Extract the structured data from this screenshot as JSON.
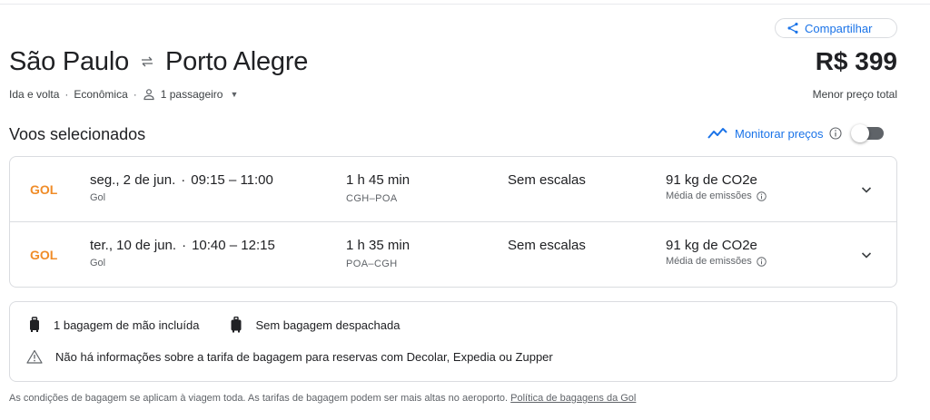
{
  "share": {
    "label": "Compartilhar",
    "icon": "share-icon"
  },
  "route": {
    "origin": "São Paulo",
    "destination": "Porto Alegre",
    "icon": "swap-arrows-icon"
  },
  "price": {
    "value": "R$ 399",
    "caption": "Menor preço total"
  },
  "trip": {
    "type": "Ida e volta",
    "cabin": "Econômica",
    "passengers": "1 passageiro"
  },
  "section": {
    "title": "Voos selecionados"
  },
  "monitor": {
    "label": "Monitorar preços",
    "enabled": false
  },
  "flights": [
    {
      "airline_logo": "GOL",
      "date_label": "seg., 2 de jun.",
      "times": "09:15 – 11:00",
      "airline": "Gol",
      "duration": "1 h 45 min",
      "route": "CGH–POA",
      "stops": "Sem escalas",
      "co2": "91 kg de CO2e",
      "emission_note": "Média de emissões"
    },
    {
      "airline_logo": "GOL",
      "date_label": "ter., 10 de jun.",
      "times": "10:40 – 12:15",
      "airline": "Gol",
      "duration": "1 h 35 min",
      "route": "POA–CGH",
      "stops": "Sem escalas",
      "co2": "91 kg de CO2e",
      "emission_note": "Média de emissões"
    }
  ],
  "baggage": {
    "carry_on": "1 bagagem de mão incluída",
    "checked": "Sem bagagem despachada",
    "warning": "Não há informações sobre a tarifa de bagagem para reservas com Decolar, Expedia ou Zupper"
  },
  "footnote": {
    "text": "As condições de bagagem se aplicam à viagem toda. As tarifas de bagagem podem ser mais altas no aeroporto. ",
    "link": "Política de bagagens da Gol"
  },
  "colors": {
    "accent": "#1a73e8",
    "gol_orange": "#f08c28",
    "border": "#dadce0",
    "text_secondary": "#5f6368"
  }
}
